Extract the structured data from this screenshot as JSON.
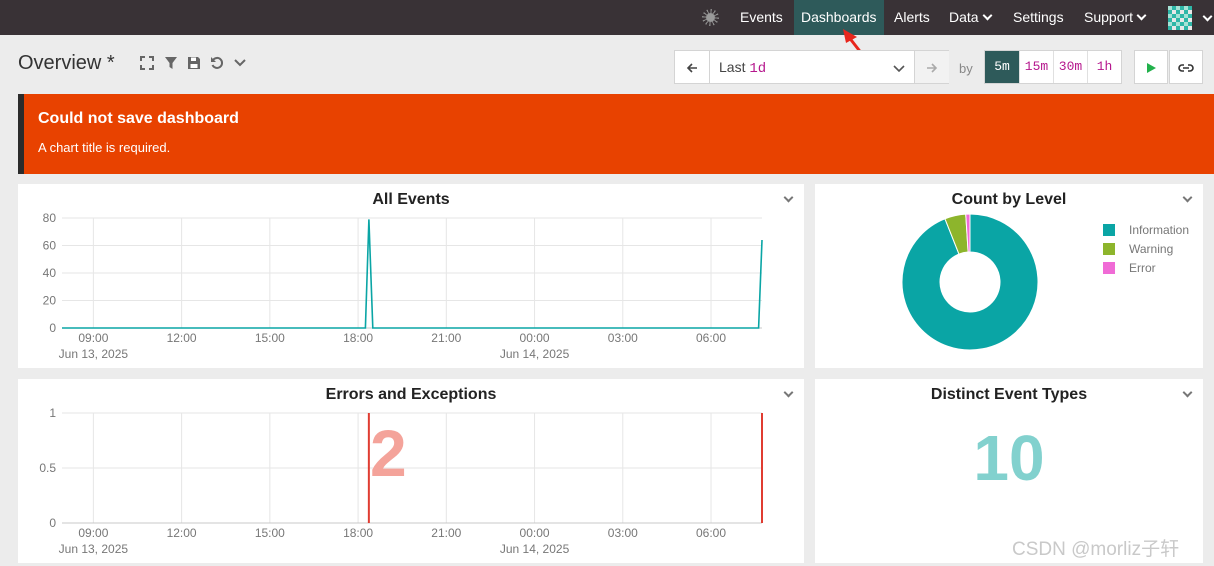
{
  "nav": {
    "items": [
      {
        "label": "Events",
        "left": 733
      },
      {
        "label": "Dashboards",
        "left": 794
      },
      {
        "label": "Alerts",
        "left": 887
      },
      {
        "label": "Data",
        "left": 942
      },
      {
        "label": "Settings",
        "left": 1006
      },
      {
        "label": "Support",
        "left": 1077
      }
    ]
  },
  "toolbar": {
    "title": "Overview *",
    "range_prefix": "Last",
    "range_value": "1d",
    "by_label": "by",
    "intervals": [
      "5m",
      "15m",
      "30m",
      "1h"
    ]
  },
  "banner": {
    "title": "Could not save dashboard",
    "message": "A chart title is required."
  },
  "panels": {
    "all_events": {
      "title": "All Events"
    },
    "count_by_level": {
      "title": "Count by Level"
    },
    "errors": {
      "title": "Errors and Exceptions",
      "value": "2"
    },
    "distinct": {
      "title": "Distinct Event Types",
      "value": "10"
    }
  },
  "colors": {
    "accent": "#2e5a5a",
    "banner": "#e84200",
    "line": "#0aa5a5",
    "error_line": "#e03c31"
  },
  "chart_data": [
    {
      "type": "line",
      "title": "All Events",
      "x_ticks": [
        "09:00",
        "12:00",
        "15:00",
        "18:00",
        "21:00",
        "00:00",
        "03:00",
        "06:00"
      ],
      "x_date_labels": [
        {
          "under": "09:00",
          "label": "Jun 13, 2025"
        },
        {
          "under": "00:00",
          "label": "Jun 14, 2025"
        }
      ],
      "ylim": [
        0,
        80
      ],
      "y_ticks": [
        "0",
        "20",
        "40",
        "60",
        "80"
      ],
      "series": [
        {
          "points": [
            [
              "07:56",
              0
            ],
            [
              "18:15",
              0
            ],
            [
              "18:22",
              79
            ],
            [
              "18:30",
              0
            ],
            [
              "07:37",
              0
            ],
            [
              "07:44",
              64
            ]
          ]
        }
      ]
    },
    {
      "type": "pie",
      "title": "Count by Level",
      "legend_position": "right",
      "slices": [
        {
          "label": "Information",
          "value": 94,
          "color": "#0aa5a5"
        },
        {
          "label": "Warning",
          "value": 5,
          "color": "#8db52c"
        },
        {
          "label": "Error",
          "value": 1,
          "color": "#f06bd6"
        }
      ]
    },
    {
      "type": "line",
      "title": "Errors and Exceptions",
      "x_ticks": [
        "09:00",
        "12:00",
        "15:00",
        "18:00",
        "21:00",
        "00:00",
        "03:00",
        "06:00"
      ],
      "x_date_labels": [
        {
          "under": "09:00",
          "label": "Jun 13, 2025"
        },
        {
          "under": "00:00",
          "label": "Jun 14, 2025"
        }
      ],
      "ylim": [
        0,
        1
      ],
      "y_ticks": [
        "0",
        "0.5",
        "1"
      ],
      "marker_times": [
        "18:22",
        "07:44"
      ]
    }
  ],
  "watermark": "CSDN @morliz子轩"
}
